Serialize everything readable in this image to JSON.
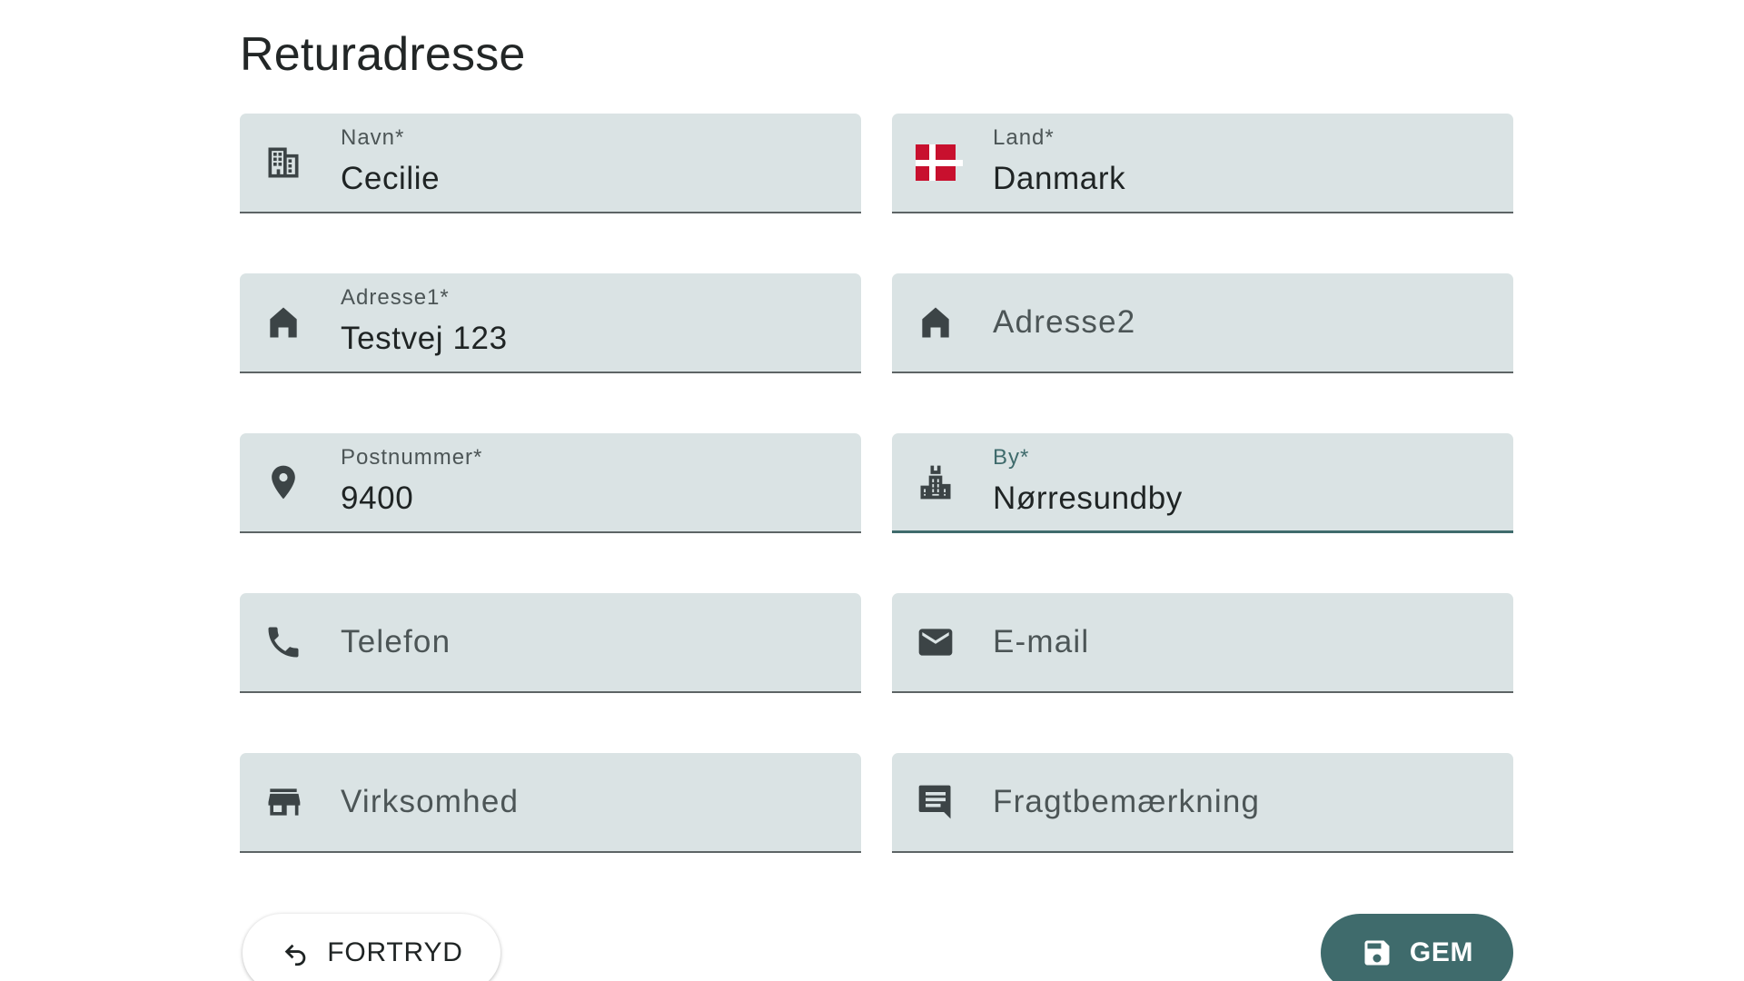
{
  "page": {
    "title": "Returadresse"
  },
  "colors": {
    "field_background": "#dae3e4",
    "accent": "#3f6b6c",
    "flag_red": "#c8102e"
  },
  "form": {
    "name": {
      "label": "Navn*",
      "value": "Cecilie",
      "icon": "building-icon"
    },
    "country": {
      "label": "Land*",
      "value": "Danmark",
      "icon": "denmark-flag-icon"
    },
    "address1": {
      "label": "Adresse1*",
      "value": "Testvej 123",
      "icon": "home-icon"
    },
    "address2": {
      "placeholder": "Adresse2",
      "icon": "home-icon"
    },
    "postal_code": {
      "label": "Postnummer*",
      "value": "9400",
      "icon": "location-pin-icon"
    },
    "city": {
      "label": "By*",
      "value": "Nørresundby",
      "icon": "city-icon",
      "focused": true
    },
    "phone": {
      "placeholder": "Telefon",
      "icon": "phone-icon"
    },
    "email": {
      "placeholder": "E-mail",
      "icon": "mail-icon"
    },
    "company": {
      "placeholder": "Virksomhed",
      "icon": "store-icon"
    },
    "freight_note": {
      "placeholder": "Fragtbemærkning",
      "icon": "comment-icon"
    }
  },
  "actions": {
    "cancel_label": "FORTRYD",
    "cancel_icon": "undo-icon",
    "save_label": "GEM",
    "save_icon": "save-icon"
  }
}
